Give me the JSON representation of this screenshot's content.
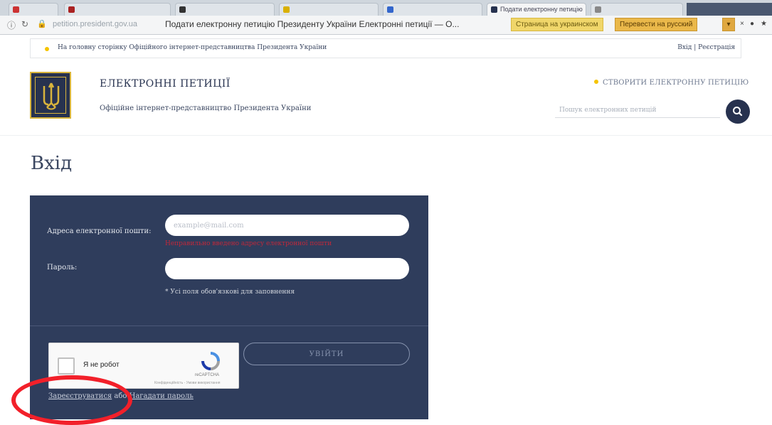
{
  "browser": {
    "active_tab_label": "Подати електронну петицію",
    "url_domain": "petition.president.gov.ua",
    "page_title": "Подати електронну петицію Президенту України Електронні петиції — О...",
    "translate_ua": "Страница на украинском",
    "translate_ru": "Перевести на русский",
    "translate_dropdown": "▾"
  },
  "topstrip": {
    "home_link": "На головну сторінку Офіційного інтернет-представництва Президента України",
    "auth_link": "Вхід | Реєстрація"
  },
  "header": {
    "title": "ЕЛЕКТРОННІ ПЕТИЦІЇ",
    "subtitle": "Офіційне інтернет-представництво Президента України",
    "create_link": "СТВОРИТИ ЕЛЕКТРОННУ ПЕТИЦІЮ",
    "search_placeholder": "Пошук електронних петицій"
  },
  "login": {
    "page_title": "Вхід",
    "email_label": "Адреса електронної пошти:",
    "email_placeholder": "example@mail.com",
    "email_error": "Неправильно введено адресу електронної пошти",
    "password_label": "Пароль:",
    "required_hint": "* Усі поля обов'язкові для заповнення",
    "captcha_label": "Я не робот",
    "captcha_brand": "reCAPTCHA",
    "captcha_terms": "Конфіденційність - Умови використання",
    "submit_label": "УВІЙТИ",
    "register_link": "Зареєструватися",
    "links_separator": " або ",
    "forgot_link": "Нагадати пароль"
  },
  "colors": {
    "panel_bg": "#2f3d5c",
    "accent_yellow": "#f5c400",
    "error_red": "#c0283a",
    "highlight_red": "#f2202a"
  }
}
